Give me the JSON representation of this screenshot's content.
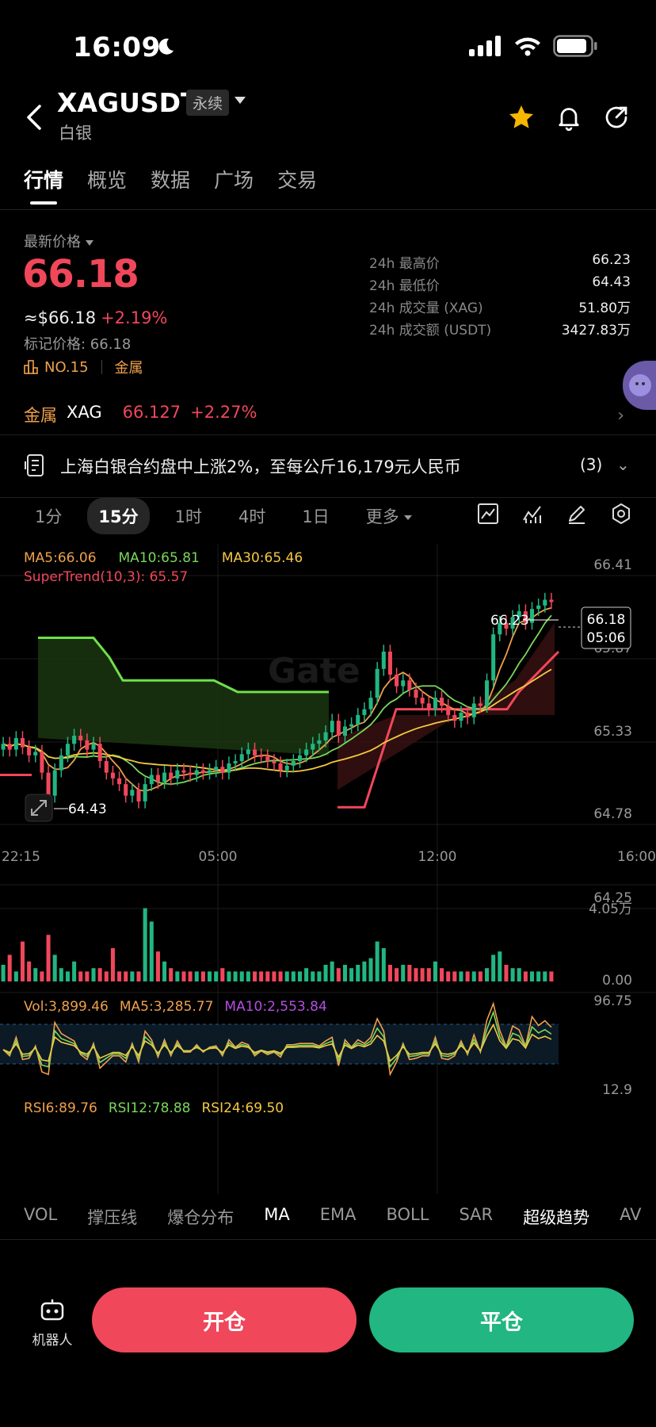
{
  "status": {
    "time": "16:09"
  },
  "header": {
    "symbol": "XAGUSDT",
    "badge": "永续",
    "subtitle": "白银"
  },
  "tabs": [
    {
      "label": "行情",
      "active": true
    },
    {
      "label": "概览",
      "active": false
    },
    {
      "label": "数据",
      "active": false
    },
    {
      "label": "广场",
      "active": false
    },
    {
      "label": "交易",
      "active": false
    }
  ],
  "price": {
    "latest_label": "最新价格",
    "last": "66.18",
    "usd": "≈$66.18",
    "change": "+2.19%",
    "mark": "标记价格: 66.18",
    "rank": "NO.15",
    "category": "金属"
  },
  "stats": [
    {
      "k": "24h 最高价",
      "v": "66.23"
    },
    {
      "k": "24h 最低价",
      "v": "64.43"
    },
    {
      "k": "24h 成交量 (XAG)",
      "v": "51.80万"
    },
    {
      "k": "24h 成交额 (USDT)",
      "v": "3427.83万"
    }
  ],
  "metal": {
    "tag": "金属",
    "code": "XAG",
    "price": "66.127",
    "change": "+2.27%"
  },
  "news": {
    "text": "上海白银合约盘中上涨2%，至每公斤16,179元人民币",
    "count": "(3)"
  },
  "timeframes": [
    {
      "label": "1分",
      "active": false
    },
    {
      "label": "15分",
      "active": true
    },
    {
      "label": "1时",
      "active": false
    },
    {
      "label": "4时",
      "active": false
    },
    {
      "label": "1日",
      "active": false
    }
  ],
  "more_label": "更多",
  "legend": {
    "ma5": "MA5:66.06",
    "ma10": "MA10:65.81",
    "ma30": "MA30:65.46",
    "supertrend": "SuperTrend(10,3): 65.57",
    "vol": "Vol:3,899.46",
    "vol_ma5": "MA5:3,285.77",
    "vol_ma10": "MA10:2,553.84",
    "rsi6": "RSI6:89.76",
    "rsi12": "RSI12:78.88",
    "rsi24": "RSI24:69.50"
  },
  "chart_data": {
    "type": "candlestick",
    "price_axis": [
      "66.41",
      "65.87",
      "65.33",
      "64.78",
      "64.25"
    ],
    "time_axis": [
      "22:15",
      "05:00",
      "12:00",
      "16:00"
    ],
    "vol_axis": [
      "4.05万",
      "0.00"
    ],
    "rsi_axis": [
      "96.75",
      "12.9"
    ],
    "high_label": "66.23",
    "low_label": "64.43",
    "last_price": "66.18",
    "countdown": "05:06",
    "ylim": [
      64.25,
      66.41
    ],
    "closes": [
      64.95,
      64.9,
      65.0,
      64.92,
      64.85,
      64.88,
      64.7,
      64.5,
      64.72,
      64.85,
      64.95,
      65.02,
      64.98,
      64.9,
      64.95,
      64.8,
      64.7,
      64.65,
      64.6,
      64.5,
      64.55,
      64.45,
      64.6,
      64.68,
      64.62,
      64.7,
      64.65,
      64.72,
      64.7,
      64.68,
      64.72,
      64.7,
      64.72,
      64.75,
      64.7,
      64.78,
      64.8,
      64.86,
      64.9,
      64.85,
      64.84,
      64.8,
      64.78,
      64.72,
      64.76,
      64.8,
      64.85,
      64.9,
      64.95,
      64.98,
      65.05,
      65.15,
      65.02,
      65.1,
      65.12,
      65.2,
      65.25,
      65.35,
      65.6,
      65.75,
      65.55,
      65.45,
      65.5,
      65.42,
      65.35,
      65.3,
      65.25,
      65.35,
      65.28,
      65.2,
      65.15,
      65.22,
      65.18,
      65.3,
      65.28,
      65.5,
      65.9,
      66.0,
      65.95,
      66.05,
      66.1,
      66.0,
      66.12,
      66.15,
      66.2,
      66.18
    ]
  },
  "indicators": [
    "VOL",
    "撑压线",
    "爆仓分布",
    "MA",
    "EMA",
    "BOLL",
    "SAR",
    "超级趋势",
    "AV"
  ],
  "indicators_on": [
    "MA",
    "超级趋势"
  ],
  "bottom": {
    "robot_label": "机器人",
    "open": "开仓",
    "close": "平仓"
  }
}
